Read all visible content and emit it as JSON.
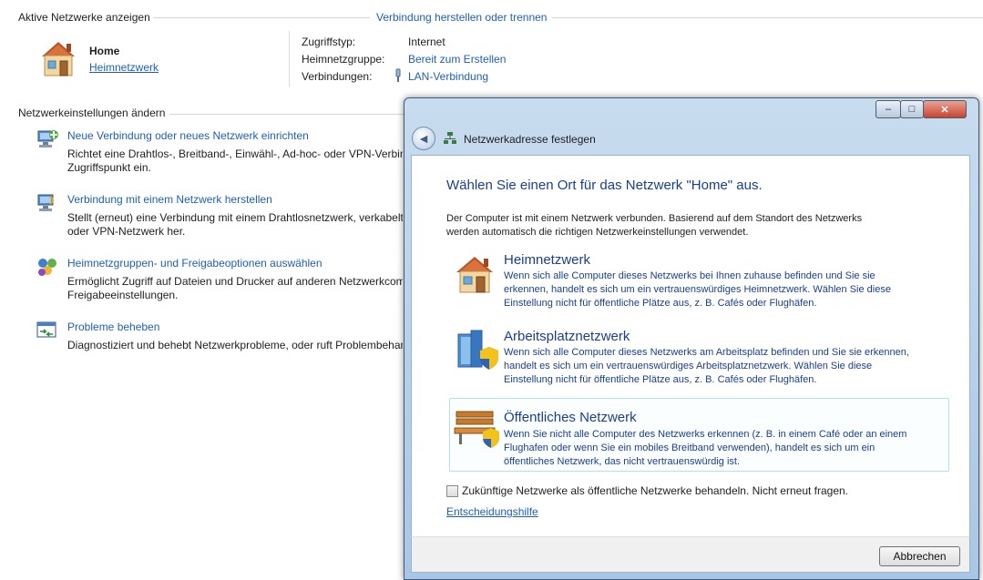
{
  "background": {
    "active_networks_header": "Aktive Netzwerke anzeigen",
    "connect_link": "Verbindung herstellen oder trennen",
    "network_name": "Home",
    "network_type_link": "Heimnetzwerk",
    "access_type_label": "Zugriffstyp:",
    "access_type_value": "Internet",
    "homegroup_label": "Heimnetzgruppe:",
    "homegroup_value": "Bereit zum Erstellen",
    "connections_label": "Verbindungen:",
    "connections_value": "LAN-Verbindung",
    "change_settings_header": "Netzwerkeinstellungen ändern",
    "tasks": [
      {
        "title": "Neue Verbindung oder neues Netzwerk einrichten",
        "desc_line1": "Richtet eine Drahtlos-, Breitband-, Einwähl-, Ad-hoc- oder VPN-Verbindung",
        "desc_line2": "Zugriffspunkt ein."
      },
      {
        "title": "Verbindung mit einem Netzwerk herstellen",
        "desc_line1": "Stellt (erneut) eine Verbindung mit einem Drahtlosnetzwerk, verkabelten",
        "desc_line2": "oder VPN-Netzwerk her."
      },
      {
        "title": "Heimnetzgruppen- und Freigabeoptionen auswählen",
        "desc_line1": "Ermöglicht Zugriff auf Dateien und Drucker auf anderen Netzwerkcomputern",
        "desc_line2": "Freigabeeinstellungen."
      },
      {
        "title": "Probleme beheben",
        "desc_line1": "Diagnostiziert und behebt Netzwerkprobleme, oder ruft Problembehandlungs",
        "desc_line2": ""
      }
    ]
  },
  "dialog": {
    "title": "Netzwerkadresse festlegen",
    "heading": "Wählen Sie einen Ort für das Netzwerk \"Home\" aus.",
    "intro_line1": "Der Computer ist mit einem Netzwerk verbunden. Basierend auf dem Standort des Netzwerks",
    "intro_line2": "werden automatisch die richtigen Netzwerkeinstellungen verwendet.",
    "options": [
      {
        "title": "Heimnetzwerk",
        "line1": "Wenn sich alle Computer dieses Netzwerks bei Ihnen zuhause befinden und Sie sie",
        "line2": "erkennen, handelt es sich um ein vertrauenswürdiges Heimnetzwerk. Wählen Sie diese",
        "line3": "Einstellung nicht für öffentliche Plätze aus, z. B. Cafés oder Flughäfen."
      },
      {
        "title": "Arbeitsplatznetzwerk",
        "line1": "Wenn sich alle Computer dieses Netzwerks am Arbeitsplatz befinden und Sie sie erkennen,",
        "line2": "handelt es sich um ein vertrauenswürdiges Arbeitsplatznetzwerk. Wählen Sie diese",
        "line3": "Einstellung nicht für öffentliche Plätze aus, z. B. Cafés oder Flughäfen."
      },
      {
        "title": "Öffentliches Netzwerk",
        "line1": "Wenn Sie nicht alle Computer des Netzwerks erkennen (z. B. in einem Café oder an einem",
        "line2": "Flughafen oder wenn Sie ein mobiles Breitband verwenden), handelt es sich um ein",
        "line3": "öffentliches Netzwerk, das nicht vertrauenswürdig ist."
      }
    ],
    "checkbox_label": "Zukünftige Netzwerke als öffentliche Netzwerke behandeln. Nicht erneut fragen.",
    "help_link": "Entscheidungshilfe",
    "cancel_button": "Abbrechen",
    "minimize_glyph": "‒",
    "maximize_glyph": "□",
    "close_glyph": "✕",
    "back_glyph": "◄"
  }
}
